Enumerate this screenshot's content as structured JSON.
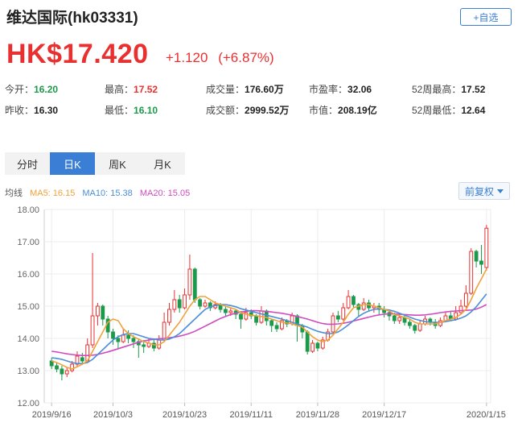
{
  "header": {
    "title": "维达国际(hk03331)",
    "add_label": "+自选"
  },
  "quote": {
    "price": "HK$17.420",
    "change": "+1.120",
    "change_pct": "(+6.87%)"
  },
  "stats": {
    "open_label": "今开：",
    "open": "16.20",
    "prev_label": "昨收：",
    "prev": "16.30",
    "high_label": "最高：",
    "high": "17.52",
    "low_label": "最低：",
    "low": "16.10",
    "volume_label": "成交量：",
    "volume": "176.60万",
    "amount_label": "成交额：",
    "amount": "2999.52万",
    "pe_label": "市盈率：",
    "pe": "32.06",
    "mcap_label": "市值：",
    "mcap": "208.19亿",
    "w52high_label": "52周最高：",
    "w52high": "17.52",
    "w52low_label": "52周最低：",
    "w52low": "12.64"
  },
  "tabs": [
    "分时",
    "日K",
    "周K",
    "月K"
  ],
  "active_tab": 1,
  "ma": {
    "label": "均线",
    "ma5": "MA5: 16.15",
    "ma10": "MA10: 15.38",
    "ma20": "MA20: 15.05"
  },
  "adjust": {
    "label": "前复权"
  },
  "colors": {
    "up": "#e93030",
    "down": "#1a9a4a",
    "ma5": "#f0a23a",
    "ma10": "#4a8fd8",
    "ma20": "#d14bc0",
    "accent": "#3a7fd5"
  },
  "chart_data": {
    "type": "candlestick",
    "ylim": [
      12,
      18
    ],
    "y_ticks": [
      "18.00",
      "17.00",
      "16.00",
      "15.00",
      "14.00",
      "13.00",
      "12.00"
    ],
    "x_tick_labels": [
      "2019/9/16",
      "2019/10/3",
      "2019/10/23",
      "2019/11/11",
      "2019/11/28",
      "2019/12/17",
      "2020/1/15"
    ],
    "x_tick_index": [
      0,
      12,
      26,
      39,
      52,
      65,
      85
    ],
    "candles": [
      [
        13.3,
        13.15,
        13.4,
        13.05
      ],
      [
        13.15,
        13.05,
        13.25,
        12.95
      ],
      [
        13.05,
        12.9,
        13.15,
        12.7
      ],
      [
        12.9,
        13.0,
        13.1,
        12.8
      ],
      [
        13.0,
        13.2,
        13.3,
        12.95
      ],
      [
        13.2,
        13.45,
        13.6,
        13.1
      ],
      [
        13.4,
        13.3,
        13.55,
        13.2
      ],
      [
        13.3,
        13.8,
        14.0,
        13.25
      ],
      [
        13.8,
        14.7,
        16.65,
        13.7
      ],
      [
        14.7,
        15.0,
        15.1,
        14.4
      ],
      [
        15.0,
        14.6,
        15.05,
        14.4
      ],
      [
        14.6,
        14.2,
        14.7,
        14.0
      ],
      [
        14.2,
        14.0,
        14.3,
        13.8
      ],
      [
        14.0,
        13.9,
        14.1,
        13.7
      ],
      [
        13.9,
        14.1,
        14.3,
        13.85
      ],
      [
        14.1,
        14.0,
        14.25,
        13.85
      ],
      [
        14.0,
        13.9,
        14.1,
        13.7
      ],
      [
        13.9,
        13.8,
        14.0,
        13.4
      ],
      [
        13.8,
        13.75,
        13.95,
        13.55
      ],
      [
        13.75,
        13.85,
        14.0,
        13.7
      ],
      [
        13.85,
        13.7,
        13.95,
        13.6
      ],
      [
        13.7,
        13.95,
        14.1,
        13.65
      ],
      [
        13.95,
        14.5,
        14.8,
        13.9
      ],
      [
        14.5,
        14.9,
        15.1,
        14.4
      ],
      [
        14.9,
        15.2,
        15.5,
        14.8
      ],
      [
        15.2,
        14.95,
        15.35,
        14.8
      ],
      [
        14.95,
        15.35,
        15.55,
        14.9
      ],
      [
        15.35,
        16.15,
        16.6,
        15.2
      ],
      [
        16.15,
        15.2,
        16.2,
        15.1
      ],
      [
        15.2,
        15.0,
        15.25,
        14.9
      ],
      [
        15.0,
        15.1,
        15.2,
        14.95
      ],
      [
        15.1,
        14.95,
        15.15,
        14.85
      ],
      [
        14.95,
        15.05,
        15.15,
        14.9
      ],
      [
        15.05,
        14.9,
        15.1,
        14.8
      ],
      [
        14.9,
        14.8,
        15.0,
        14.7
      ],
      [
        14.8,
        14.85,
        14.95,
        14.7
      ],
      [
        14.85,
        14.75,
        14.9,
        14.6
      ],
      [
        14.75,
        14.6,
        14.85,
        14.3
      ],
      [
        14.6,
        14.8,
        14.95,
        14.55
      ],
      [
        14.8,
        14.7,
        14.9,
        14.6
      ],
      [
        14.7,
        14.5,
        14.75,
        14.4
      ],
      [
        14.5,
        14.85,
        15.0,
        14.45
      ],
      [
        14.85,
        14.55,
        14.9,
        14.4
      ],
      [
        14.55,
        14.4,
        14.6,
        14.2
      ],
      [
        14.4,
        14.3,
        14.5,
        14.2
      ],
      [
        14.3,
        14.55,
        14.65,
        14.25
      ],
      [
        14.55,
        14.45,
        14.6,
        14.35
      ],
      [
        14.45,
        14.7,
        14.8,
        14.4
      ],
      [
        14.7,
        14.4,
        14.75,
        13.9
      ],
      [
        14.4,
        14.2,
        14.45,
        14.0
      ],
      [
        14.2,
        13.6,
        14.25,
        13.5
      ],
      [
        13.6,
        13.85,
        13.95,
        13.55
      ],
      [
        13.85,
        13.7,
        13.9,
        13.6
      ],
      [
        13.7,
        13.95,
        14.05,
        13.65
      ],
      [
        13.95,
        14.2,
        14.3,
        13.9
      ],
      [
        14.2,
        14.7,
        14.8,
        14.15
      ],
      [
        14.7,
        14.6,
        14.85,
        14.5
      ],
      [
        14.6,
        14.95,
        15.1,
        14.55
      ],
      [
        14.95,
        15.3,
        15.5,
        14.9
      ],
      [
        15.3,
        15.05,
        15.35,
        14.95
      ],
      [
        15.05,
        14.9,
        15.1,
        14.7
      ],
      [
        14.9,
        15.1,
        15.25,
        14.85
      ],
      [
        15.1,
        14.95,
        15.2,
        14.85
      ],
      [
        14.95,
        15.0,
        15.1,
        14.8
      ],
      [
        15.0,
        14.9,
        15.1,
        14.75
      ],
      [
        14.9,
        14.8,
        15.0,
        14.65
      ],
      [
        14.8,
        14.7,
        14.9,
        14.55
      ],
      [
        14.7,
        14.55,
        14.8,
        14.45
      ],
      [
        14.55,
        14.65,
        14.75,
        14.45
      ],
      [
        14.65,
        14.5,
        14.7,
        14.4
      ],
      [
        14.5,
        14.4,
        14.6,
        14.3
      ],
      [
        14.4,
        14.25,
        14.45,
        14.15
      ],
      [
        14.25,
        14.45,
        14.55,
        14.2
      ],
      [
        14.45,
        14.6,
        14.7,
        14.4
      ],
      [
        14.6,
        14.5,
        14.65,
        14.4
      ],
      [
        14.5,
        14.4,
        14.6,
        14.3
      ],
      [
        14.4,
        14.55,
        14.65,
        14.35
      ],
      [
        14.55,
        14.7,
        14.8,
        14.5
      ],
      [
        14.7,
        14.6,
        14.85,
        14.55
      ],
      [
        14.6,
        14.8,
        15.0,
        14.55
      ],
      [
        14.8,
        15.0,
        15.2,
        14.75
      ],
      [
        15.0,
        15.4,
        15.65,
        14.95
      ],
      [
        15.4,
        16.7,
        16.8,
        15.35
      ],
      [
        16.7,
        16.4,
        16.75,
        16.2
      ],
      [
        16.4,
        16.3,
        16.9,
        16.0
      ],
      [
        16.2,
        17.42,
        17.52,
        16.1
      ]
    ],
    "ma5": [
      13.3,
      13.25,
      13.18,
      13.1,
      13.05,
      13.12,
      13.2,
      13.3,
      13.6,
      13.9,
      14.2,
      14.5,
      14.6,
      14.55,
      14.3,
      14.15,
      14.05,
      13.98,
      13.9,
      13.86,
      13.8,
      13.8,
      13.9,
      14.1,
      14.3,
      14.5,
      14.75,
      15.0,
      15.2,
      15.3,
      15.3,
      15.2,
      15.1,
      15.05,
      15.0,
      14.95,
      14.9,
      14.8,
      14.75,
      14.72,
      14.7,
      14.68,
      14.65,
      14.6,
      14.55,
      14.5,
      14.48,
      14.45,
      14.4,
      14.35,
      14.2,
      14.05,
      13.95,
      13.9,
      13.95,
      14.1,
      14.3,
      14.5,
      14.75,
      14.95,
      15.0,
      15.05,
      15.05,
      15.0,
      14.95,
      14.9,
      14.85,
      14.75,
      14.7,
      14.65,
      14.6,
      14.5,
      14.45,
      14.45,
      14.45,
      14.45,
      14.5,
      14.55,
      14.6,
      14.65,
      14.75,
      14.9,
      15.2,
      15.55,
      15.85,
      16.15
    ],
    "ma10": [
      13.4,
      13.38,
      13.35,
      13.3,
      13.25,
      13.22,
      13.22,
      13.25,
      13.35,
      13.5,
      13.65,
      13.8,
      13.95,
      14.05,
      14.12,
      14.15,
      14.15,
      14.1,
      14.05,
      14.0,
      13.98,
      13.95,
      13.95,
      13.98,
      14.05,
      14.15,
      14.3,
      14.45,
      14.6,
      14.75,
      14.9,
      14.98,
      15.02,
      15.05,
      15.05,
      15.02,
      14.98,
      14.92,
      14.88,
      14.84,
      14.8,
      14.76,
      14.72,
      14.68,
      14.64,
      14.6,
      14.55,
      14.5,
      14.45,
      14.4,
      14.35,
      14.28,
      14.22,
      14.18,
      14.15,
      14.15,
      14.2,
      14.3,
      14.42,
      14.55,
      14.68,
      14.78,
      14.85,
      14.9,
      14.92,
      14.9,
      14.88,
      14.84,
      14.78,
      14.72,
      14.66,
      14.6,
      14.56,
      14.52,
      14.5,
      14.5,
      14.5,
      14.52,
      14.55,
      14.58,
      14.63,
      14.7,
      14.82,
      14.98,
      15.18,
      15.38
    ],
    "ma20": [
      13.6,
      13.58,
      13.55,
      13.52,
      13.5,
      13.48,
      13.47,
      13.47,
      13.48,
      13.5,
      13.54,
      13.58,
      13.63,
      13.68,
      13.73,
      13.78,
      13.83,
      13.88,
      13.92,
      13.95,
      13.97,
      13.99,
      14.0,
      14.02,
      14.04,
      14.07,
      14.11,
      14.16,
      14.22,
      14.3,
      14.38,
      14.46,
      14.54,
      14.62,
      14.68,
      14.74,
      14.78,
      14.82,
      14.84,
      14.86,
      14.86,
      14.85,
      14.84,
      14.82,
      14.8,
      14.78,
      14.75,
      14.72,
      14.68,
      14.64,
      14.6,
      14.55,
      14.5,
      14.46,
      14.44,
      14.44,
      14.45,
      14.47,
      14.5,
      14.54,
      14.58,
      14.62,
      14.66,
      14.7,
      14.73,
      14.75,
      14.76,
      14.76,
      14.75,
      14.74,
      14.73,
      14.72,
      14.72,
      14.73,
      14.75,
      14.77,
      14.8,
      14.82,
      14.84,
      14.85,
      14.86,
      14.87,
      14.88,
      14.91,
      14.97,
      15.05
    ]
  }
}
